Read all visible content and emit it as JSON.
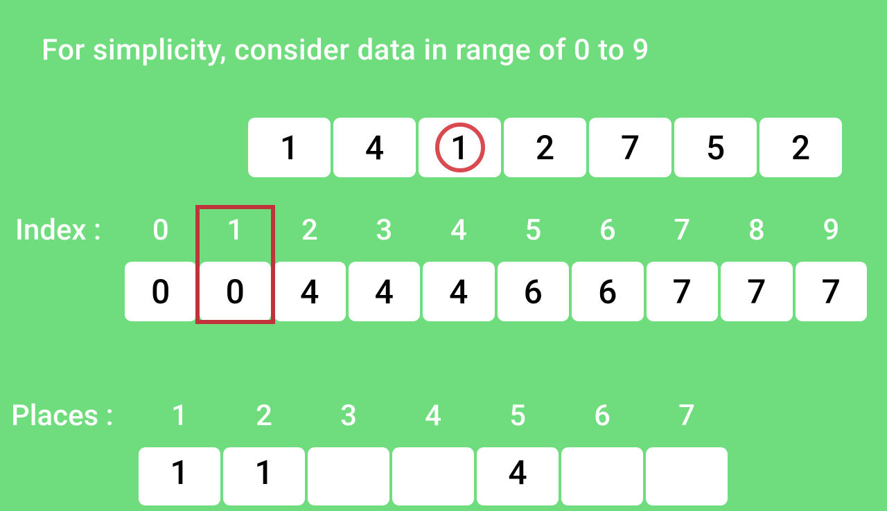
{
  "title": "For simplicity, consider data in range of 0 to 9",
  "input": {
    "values": [
      "1",
      "4",
      "1",
      "2",
      "7",
      "5",
      "2"
    ],
    "circled_index": 2
  },
  "index": {
    "label": "Index :",
    "labels": [
      "0",
      "1",
      "2",
      "3",
      "4",
      "5",
      "6",
      "7",
      "8",
      "9"
    ],
    "highlight": 1
  },
  "count": {
    "values": [
      "0",
      "0",
      "4",
      "4",
      "4",
      "6",
      "6",
      "7",
      "7",
      "7"
    ]
  },
  "places": {
    "label": "Places :",
    "indexes": [
      "1",
      "2",
      "3",
      "4",
      "5",
      "6",
      "7"
    ],
    "values": [
      "1",
      "1",
      "",
      "",
      "4",
      "",
      ""
    ]
  },
  "colors": {
    "bg": "#6fdd7d",
    "cell": "#ffffff",
    "text": "#000000",
    "highlight": "#c1333b",
    "circle": "#d84a50"
  }
}
